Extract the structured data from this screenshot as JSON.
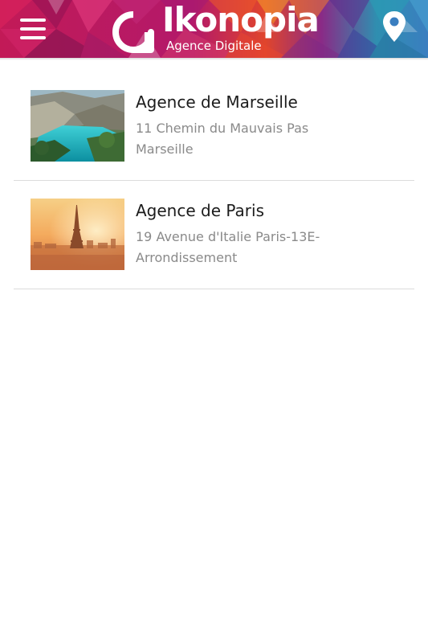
{
  "header": {
    "brand_name": "Ikonopia",
    "brand_tagline": "Agence Digitale",
    "menu_icon": "hamburger-menu-icon",
    "location_icon": "map-pin-icon",
    "colors": {
      "magenta": "#b0185a",
      "purple": "#6a2d8e",
      "orange": "#f29a2e",
      "teal": "#2a9fb7",
      "text": "#ffffff"
    }
  },
  "agencies": [
    {
      "name": "Agence de Marseille",
      "address_line1": "11 Chemin du Mauvais Pas",
      "address_line2": "Marseille",
      "thumbnail": "calanque-landscape-photo"
    },
    {
      "name": "Agence de Paris",
      "address_line1": "19 Avenue d'Italie Paris-13E-",
      "address_line2": "Arrondissement",
      "thumbnail": "eiffel-tower-sunset-photo"
    }
  ]
}
